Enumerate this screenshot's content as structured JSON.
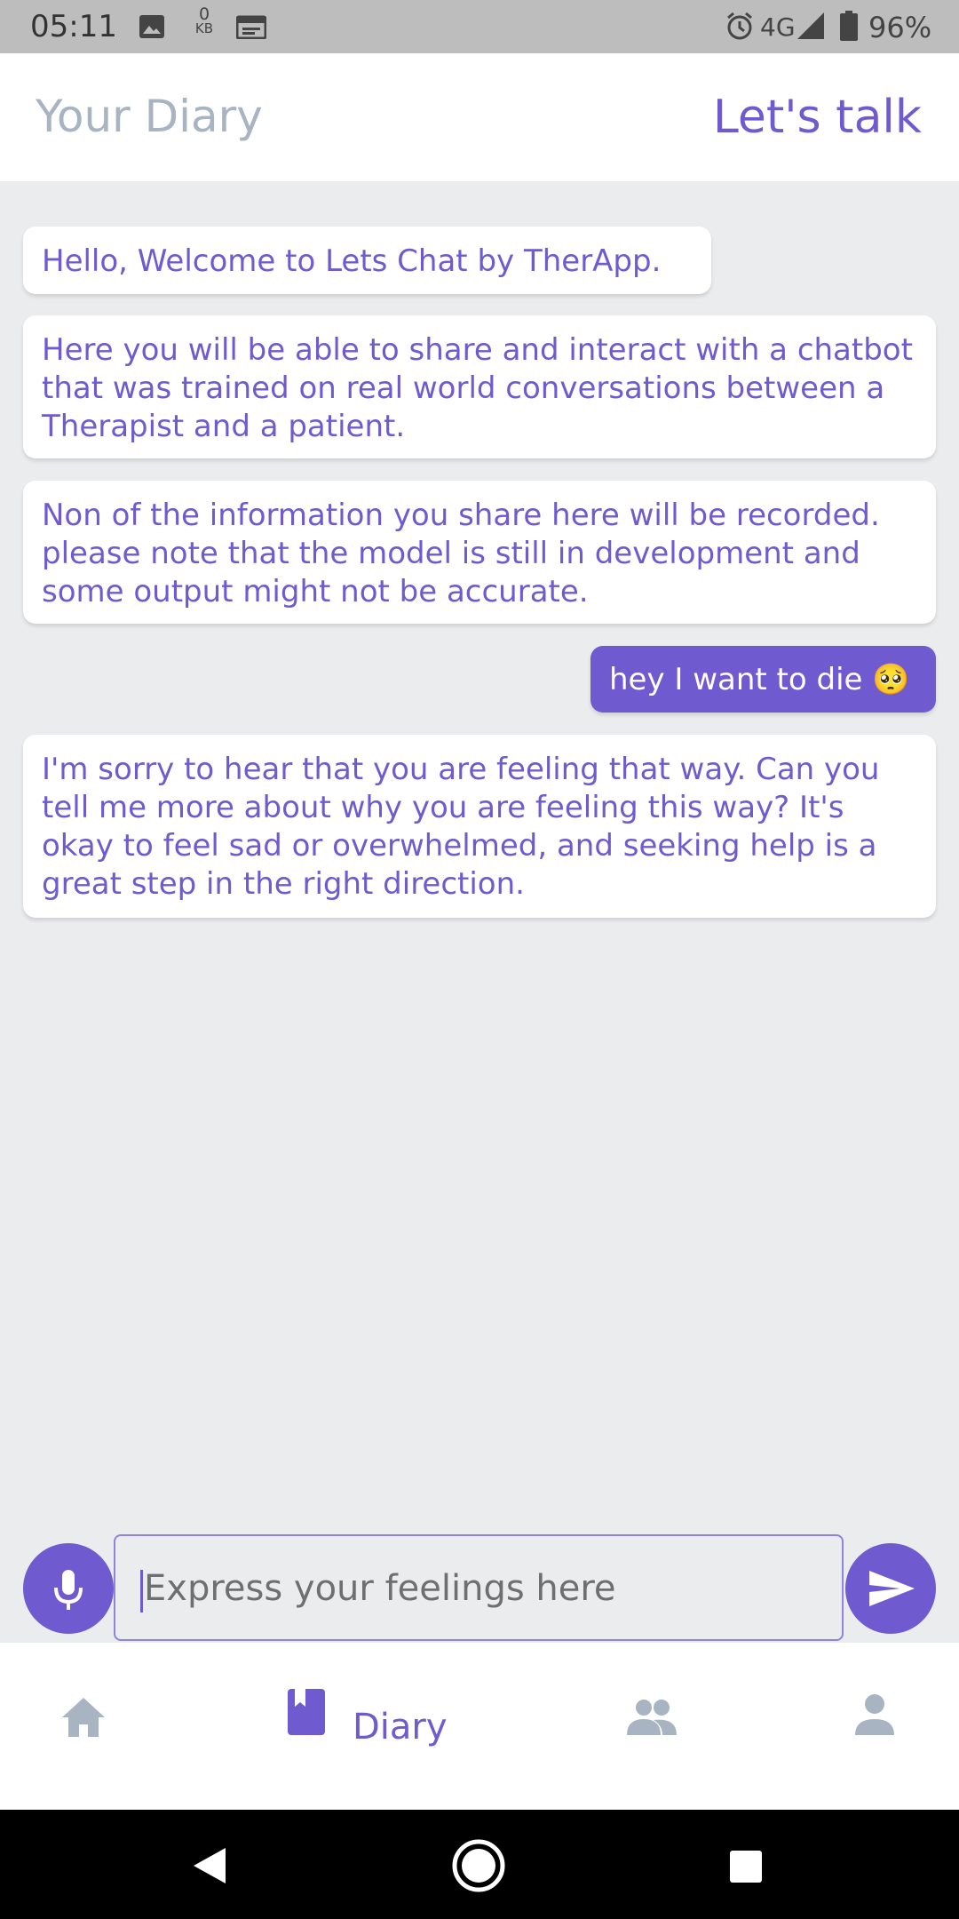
{
  "status_bar": {
    "time": "05:11",
    "data_counter_value": "0",
    "data_counter_unit": "KB",
    "network": "4G",
    "battery": "96%",
    "icons": [
      "image-icon",
      "data-counter-icon",
      "calendar-icon",
      "alarm-icon",
      "signal-icon",
      "battery-icon"
    ]
  },
  "header": {
    "tab_diary": "Your Diary",
    "tab_talk": "Let's talk"
  },
  "messages": [
    {
      "sender": "bot",
      "text": "Hello, Welcome to Lets Chat by TherApp."
    },
    {
      "sender": "bot",
      "text": "Here you will be able to share and interact with a chatbot that was trained on real world conversations between a Therapist and a patient."
    },
    {
      "sender": "bot",
      "text": "Non of the information you share here will be recorded. please note that the model is still in development and some output might not be accurate."
    },
    {
      "sender": "user",
      "text": "hey I want to die 🥺"
    },
    {
      "sender": "bot",
      "text": "I'm sorry to hear that you are feeling that way. Can you tell me more about why you are feeling this way? It's okay to feel sad or overwhelmed, and seeking help is a great step in the right direction."
    }
  ],
  "input": {
    "placeholder": "Express your feelings here",
    "value": ""
  },
  "bottom_nav": {
    "items": [
      {
        "icon": "home-icon",
        "label": ""
      },
      {
        "icon": "diary-icon",
        "label": "Diary"
      },
      {
        "icon": "people-icon",
        "label": ""
      },
      {
        "icon": "profile-icon",
        "label": ""
      }
    ]
  },
  "colors": {
    "accent": "#6f5bcf",
    "inactive": "#a8b4c2",
    "background": "#ebecee",
    "status_bar": "#bdbdbd"
  }
}
